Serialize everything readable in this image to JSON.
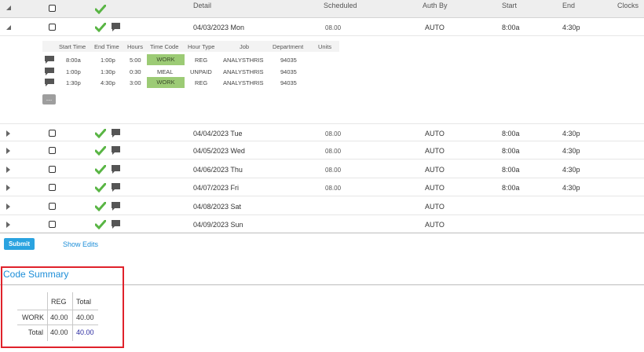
{
  "header": {
    "detail": "Detail",
    "scheduled": "Scheduled",
    "auth_by": "Auth By",
    "start": "Start",
    "end": "End",
    "clocks": "Clocks"
  },
  "expanded_day": {
    "detail": "04/03/2023 Mon",
    "scheduled": "08.00",
    "auth_by": "AUTO",
    "start": "8:00a",
    "end": "4:30p"
  },
  "punches": {
    "columns": [
      "Start Time",
      "End Time",
      "Hours",
      "Time Code",
      "Hour Type",
      "Job",
      "Department",
      "Units"
    ],
    "rows": [
      {
        "start": "8:00a",
        "end": "1:00p",
        "hours": "5:00",
        "time_code": "WORK",
        "hour_type": "REG",
        "job": "ANALYSTHRIS",
        "department": "94035"
      },
      {
        "start": "1:00p",
        "end": "1:30p",
        "hours": "0:30",
        "time_code": "MEAL",
        "hour_type": "UNPAID",
        "job": "ANALYSTHRIS",
        "department": "94035"
      },
      {
        "start": "1:30p",
        "end": "4:30p",
        "hours": "3:00",
        "time_code": "WORK",
        "hour_type": "REG",
        "job": "ANALYSTHRIS",
        "department": "94035"
      }
    ],
    "more_label": "..."
  },
  "days": [
    {
      "detail": "04/04/2023 Tue",
      "scheduled": "08.00",
      "auth_by": "AUTO",
      "start": "8:00a",
      "end": "4:30p"
    },
    {
      "detail": "04/05/2023 Wed",
      "scheduled": "08.00",
      "auth_by": "AUTO",
      "start": "8:00a",
      "end": "4:30p"
    },
    {
      "detail": "04/06/2023 Thu",
      "scheduled": "08.00",
      "auth_by": "AUTO",
      "start": "8:00a",
      "end": "4:30p"
    },
    {
      "detail": "04/07/2023 Fri",
      "scheduled": "08.00",
      "auth_by": "AUTO",
      "start": "8:00a",
      "end": "4:30p"
    },
    {
      "detail": "04/08/2023 Sat",
      "scheduled": "",
      "auth_by": "AUTO",
      "start": "",
      "end": ""
    },
    {
      "detail": "04/09/2023 Sun",
      "scheduled": "",
      "auth_by": "AUTO",
      "start": "",
      "end": ""
    }
  ],
  "actions": {
    "submit": "Submit",
    "show_edits": "Show Edits"
  },
  "code_summary": {
    "title": "Code Summary",
    "col_reg": "REG",
    "col_total": "Total",
    "row_work": "WORK",
    "row_total": "Total",
    "work_reg": "40.00",
    "work_total": "40.00",
    "total_reg": "40.00",
    "total_total": "40.00"
  },
  "colors": {
    "accent": "#2aa3e0",
    "work_badge": "#9ccb75",
    "check": "#59b544",
    "highlight_box": "#e0222b"
  }
}
